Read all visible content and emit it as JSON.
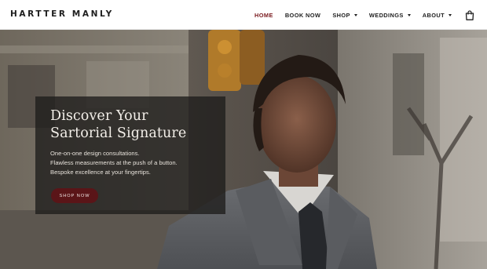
{
  "brand": {
    "name": "HARTTER MANLY"
  },
  "nav": {
    "items": [
      {
        "label": "HOME",
        "active": true,
        "has_dropdown": false
      },
      {
        "label": "BOOK NOW",
        "active": false,
        "has_dropdown": false
      },
      {
        "label": "SHOP",
        "active": false,
        "has_dropdown": true
      },
      {
        "label": "WEDDINGS",
        "active": false,
        "has_dropdown": true
      },
      {
        "label": "ABOUT",
        "active": false,
        "has_dropdown": true
      }
    ],
    "cart_icon": "shopping-bag-icon"
  },
  "hero": {
    "title_line1": "Discover Your",
    "title_line2": "Sartorial Signature",
    "lines": [
      "One-on-one design consultations.",
      "Flawless measurements at the push of a button.",
      "Bespoke excellence at your fingertips."
    ],
    "cta_label": "SHOP NOW"
  },
  "colors": {
    "accent": "#7a1a1e",
    "button": "#5a1518",
    "header_bg": "#ffffff",
    "overlay": "#1e1c1b"
  }
}
